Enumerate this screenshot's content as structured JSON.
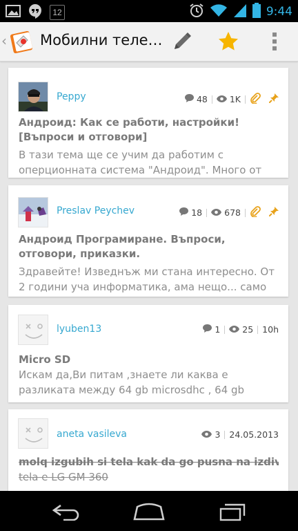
{
  "status_bar": {
    "time": "9:44",
    "notification_badge": "12",
    "left_icons": [
      "gallery-icon",
      "hangouts-icon",
      "sim-badge-icon"
    ],
    "right_icons": [
      "alarm-icon",
      "wifi-icon",
      "signal-icon",
      "battery-icon"
    ]
  },
  "action_bar": {
    "title": "Мобилни теле…",
    "actions": [
      "edit-pen-icon",
      "favorite-star-icon",
      "overflow-menu-icon"
    ],
    "colors": {
      "star": "#f7b500",
      "pen": "#6b6b6b"
    }
  },
  "topics": [
    {
      "author": "Peppy",
      "comments": "48",
      "views": "1K",
      "extra": "",
      "attachment": true,
      "pinned": true,
      "avatar": "photo",
      "title": "Андроид: Как се работи, настройки! [Въпроси и отговори]",
      "snippet": "В тази тема ще се учим да работим с оперционната система \"Андроид\". Много от",
      "strikethrough": false
    },
    {
      "author": "Preslav Peychev",
      "comments": "18",
      "views": "678",
      "extra": "",
      "attachment": true,
      "pinned": true,
      "avatar": "photo",
      "title": "Андроид Програмиране. Въпроси, отговори, приказки.",
      "snippet": "Здравейте! Изведнъж ми стана интересно. От 2 години уча информатика, ама нещо... само",
      "strikethrough": false
    },
    {
      "author": "lyuben13",
      "comments": "1",
      "views": "25",
      "extra": "10h",
      "attachment": false,
      "pinned": false,
      "avatar": "placeholder",
      "title": "Micro SD",
      "snippet": "Искам да,Ви питам ,знаете ли каква е разликата между 64 gb microsdhc , 64 gb",
      "strikethrough": false
    },
    {
      "author": "aneta vasileva",
      "comments": "",
      "views": "3",
      "extra": "24.05.2013",
      "attachment": false,
      "pinned": false,
      "avatar": "placeholder",
      "title": "molq izgubih si tela kak da go pusna na izdivane",
      "snippet": "tela e LG GM 360",
      "strikethrough": true
    }
  ],
  "nav_bar": {
    "buttons": [
      "back-icon",
      "home-icon",
      "recent-apps-icon"
    ]
  }
}
